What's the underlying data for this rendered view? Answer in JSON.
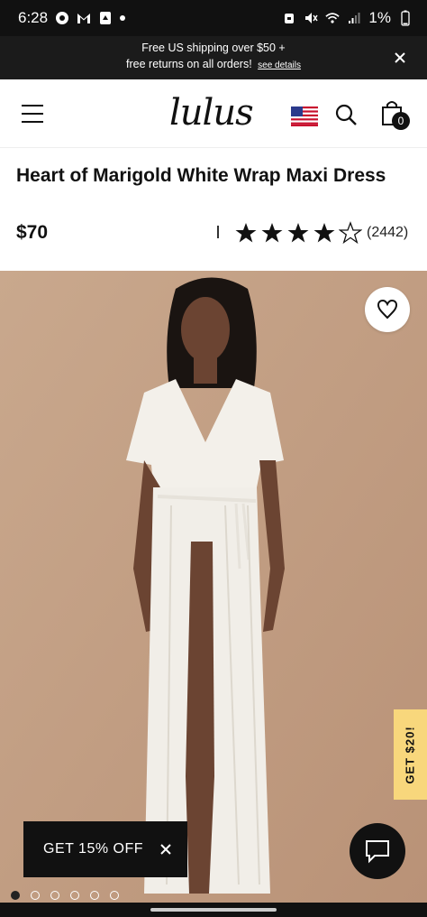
{
  "status_bar": {
    "time": "6:28",
    "battery": "1%"
  },
  "promo_banner": {
    "line1": "Free US shipping over $50 +",
    "line2": "free returns on all orders!",
    "link": "see details"
  },
  "header": {
    "logo": "lulus",
    "bag_count": "0"
  },
  "product": {
    "title": "Heart of Marigold White Wrap Maxi Dress",
    "price": "$70",
    "rating": 4,
    "rating_max": 5,
    "review_count": "(2442)"
  },
  "overlays": {
    "side_tab": "GET $20!",
    "discount_pill": "GET 15% OFF"
  },
  "carousel": {
    "total_slides": 6,
    "active_index": 0
  },
  "colors": {
    "photo_background": "#c7a58a",
    "side_tab": "#f8d77c",
    "dark": "#111111"
  }
}
